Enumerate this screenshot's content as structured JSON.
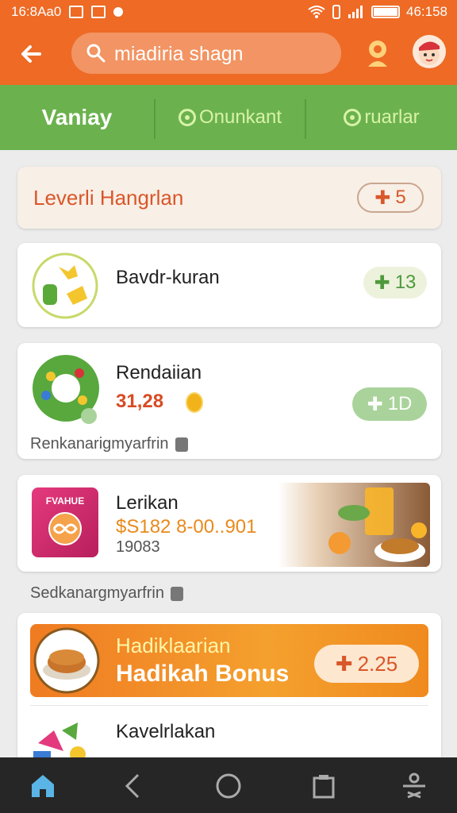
{
  "status_bar": {
    "left_text": "16:8Aa0",
    "time": "46:158"
  },
  "search": {
    "value": "miadiria shagn"
  },
  "tabs": [
    {
      "label": "Vaniay"
    },
    {
      "label": "Onunkant"
    },
    {
      "label": "ruarlar"
    }
  ],
  "level_card": {
    "title": "Leverli Hangrlan",
    "badge": "5"
  },
  "items": [
    {
      "name": "Bavdr-kuran",
      "badge": "13"
    },
    {
      "name": "Rendaiian",
      "price": "31,28",
      "badge": "1D"
    }
  ],
  "note1": "Renkanarigmyarfrin",
  "item3": {
    "name": "Lerikan",
    "price": "$S182 8-00..901",
    "extra": "19083",
    "logo_text": "FVAHUE"
  },
  "note2": "Sedkanargmyarfrin",
  "promo": {
    "title": "Hadiklaarian",
    "subtitle": "Hadikah Bonus",
    "badge": "2.25"
  },
  "item5": {
    "name": "Kavelrlakan"
  },
  "colors": {
    "header": "#ee6a25",
    "tabs": "#6bb24e",
    "accent": "#d84b23"
  }
}
